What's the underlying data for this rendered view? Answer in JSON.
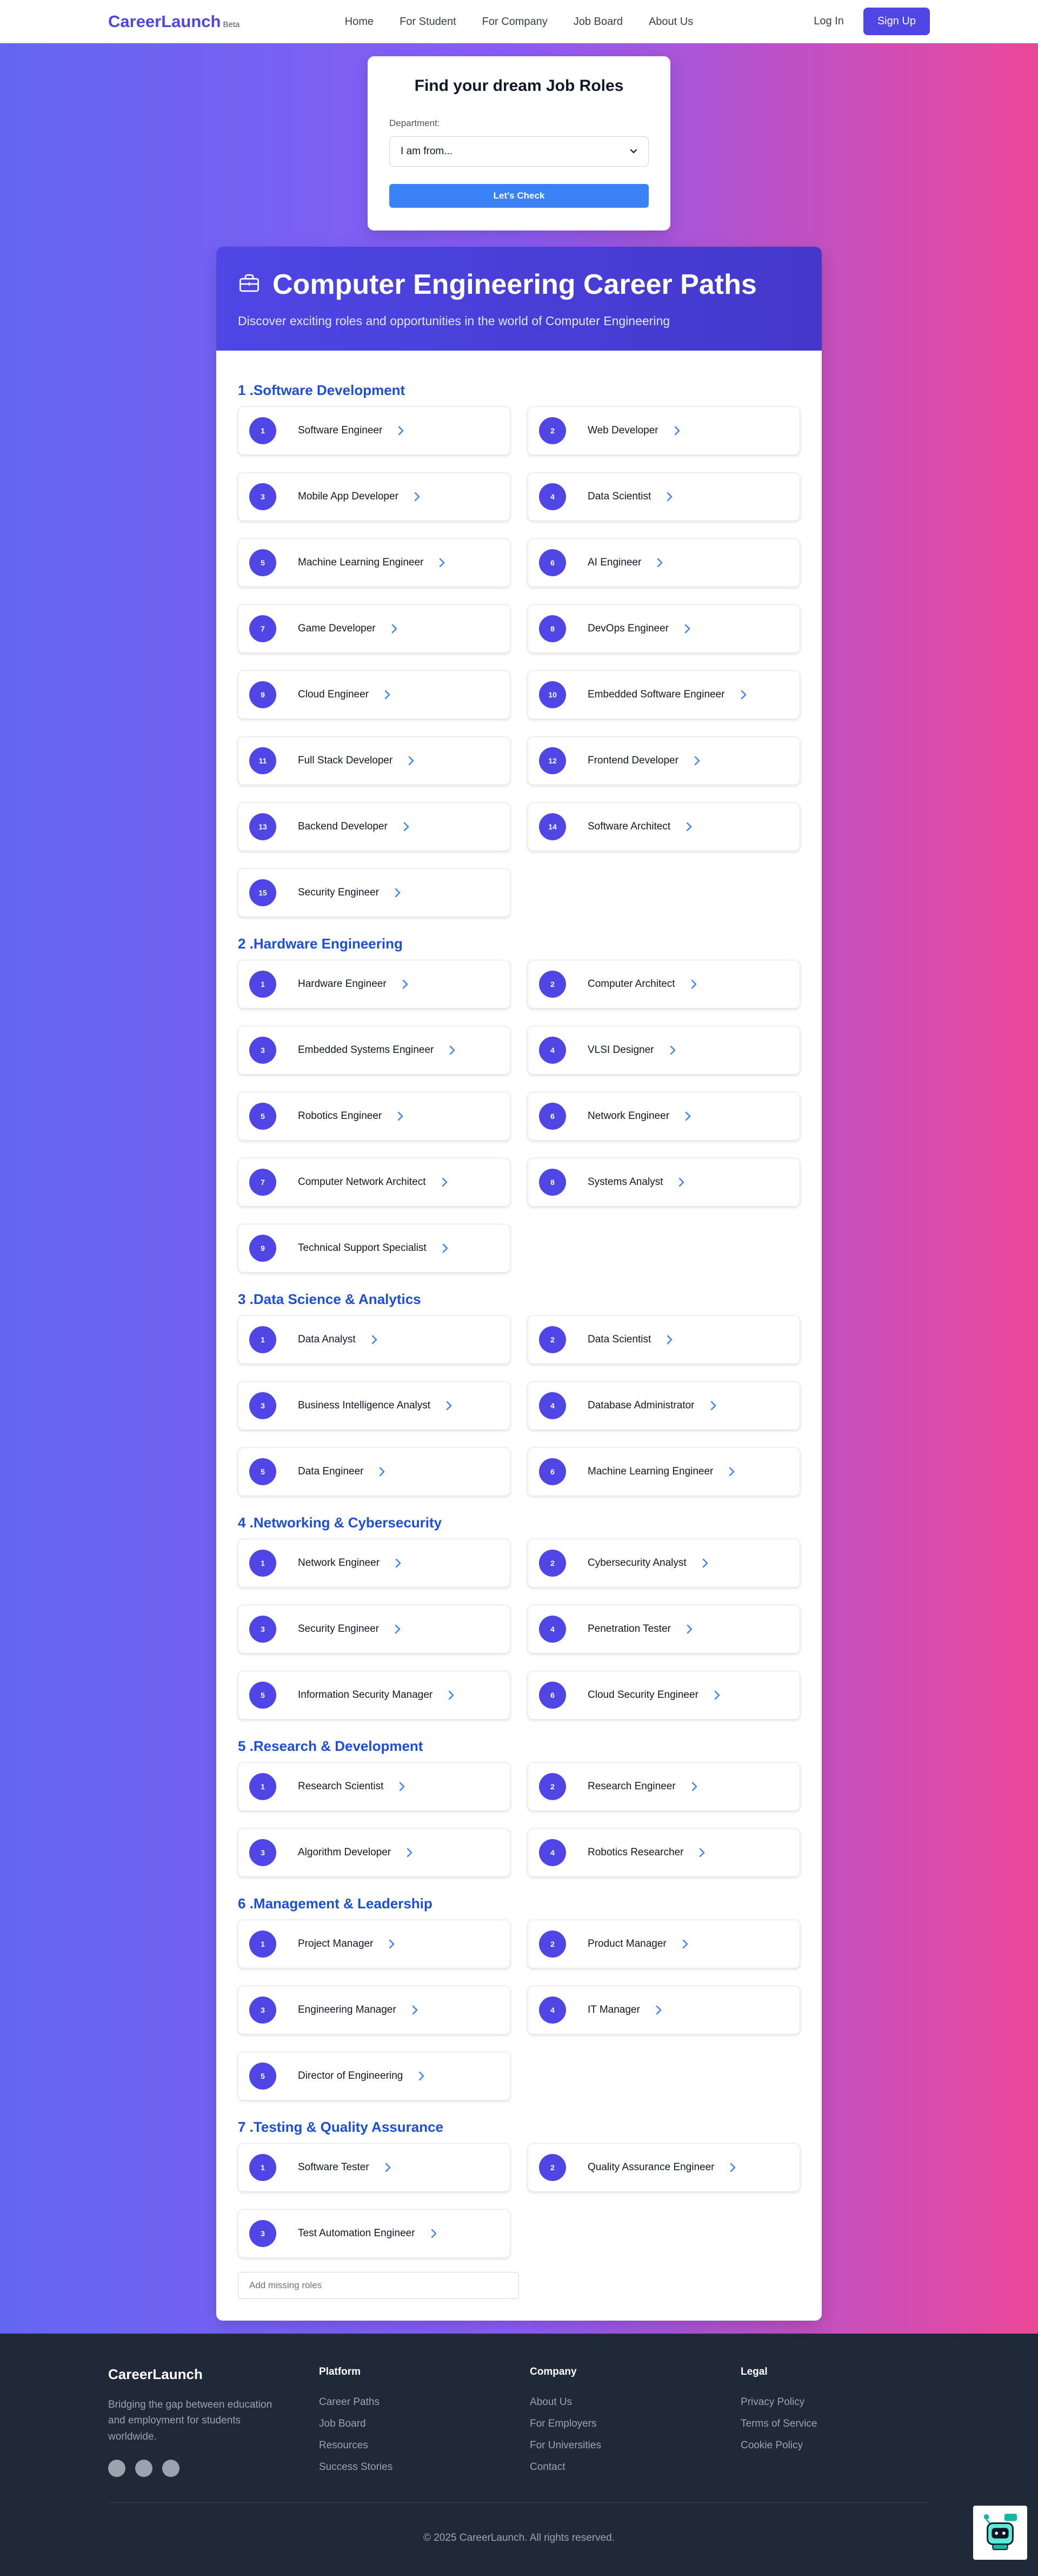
{
  "nav": {
    "brand": "CareerLaunch",
    "beta": "Beta",
    "links": [
      "Home",
      "For Student",
      "For Company",
      "Job Board",
      "About Us"
    ],
    "login": "Log In",
    "signup": "Sign Up"
  },
  "finder": {
    "title": "Find your dream Job Roles",
    "label": "Department:",
    "select_value": "I am from...",
    "button": "Let's Check"
  },
  "card": {
    "title": "Computer Engineering Career Paths",
    "subtitle": "Discover exciting roles and opportunities in the world of Computer Engineering",
    "add_placeholder": "Add missing roles",
    "sections": [
      {
        "title": "1 .Software Development",
        "roles": [
          "Software Engineer",
          "Web Developer",
          "Mobile App Developer",
          "Data Scientist",
          "Machine Learning Engineer",
          "AI Engineer",
          "Game Developer",
          "DevOps Engineer",
          "Cloud Engineer",
          "Embedded Software Engineer",
          "Full Stack Developer",
          "Frontend Developer",
          "Backend Developer",
          "Software Architect",
          "Security Engineer"
        ]
      },
      {
        "title": "2 .Hardware Engineering",
        "roles": [
          "Hardware Engineer",
          "Computer Architect",
          "Embedded Systems Engineer",
          "VLSI Designer",
          "Robotics Engineer",
          "Network Engineer",
          "Computer Network Architect",
          "Systems Analyst",
          "Technical Support Specialist"
        ]
      },
      {
        "title": "3 .Data Science & Analytics",
        "roles": [
          "Data Analyst",
          "Data Scientist",
          "Business Intelligence Analyst",
          "Database Administrator",
          "Data Engineer",
          "Machine Learning Engineer"
        ]
      },
      {
        "title": "4 .Networking & Cybersecurity",
        "roles": [
          "Network Engineer",
          "Cybersecurity Analyst",
          "Security Engineer",
          "Penetration Tester",
          "Information Security Manager",
          "Cloud Security Engineer"
        ]
      },
      {
        "title": "5 .Research & Development",
        "roles": [
          "Research Scientist",
          "Research Engineer",
          "Algorithm Developer",
          "Robotics Researcher"
        ]
      },
      {
        "title": "6 .Management & Leadership",
        "roles": [
          "Project Manager",
          "Product Manager",
          "Engineering Manager",
          "IT Manager",
          "Director of Engineering"
        ]
      },
      {
        "title": "7 .Testing & Quality Assurance",
        "roles": [
          "Software Tester",
          "Quality Assurance Engineer",
          "Test Automation Engineer"
        ]
      }
    ]
  },
  "footer": {
    "brand": "CareerLaunch",
    "desc": "Bridging the gap between education and employment for students worldwide.",
    "columns": [
      {
        "heading": "Platform",
        "links": [
          "Career Paths",
          "Job Board",
          "Resources",
          "Success Stories"
        ]
      },
      {
        "heading": "Company",
        "links": [
          "About Us",
          "For Employers",
          "For Universities",
          "Contact"
        ]
      },
      {
        "heading": "Legal",
        "links": [
          "Privacy Policy",
          "Terms of Service",
          "Cookie Policy"
        ]
      }
    ],
    "copyright": "© 2025 CareerLaunch. All rights reserved."
  },
  "colors": {
    "accent": "#4f46e5",
    "link_blue": "#3b82f6",
    "section_title": "#1d4ed8",
    "footer_bg": "#1f2937"
  }
}
